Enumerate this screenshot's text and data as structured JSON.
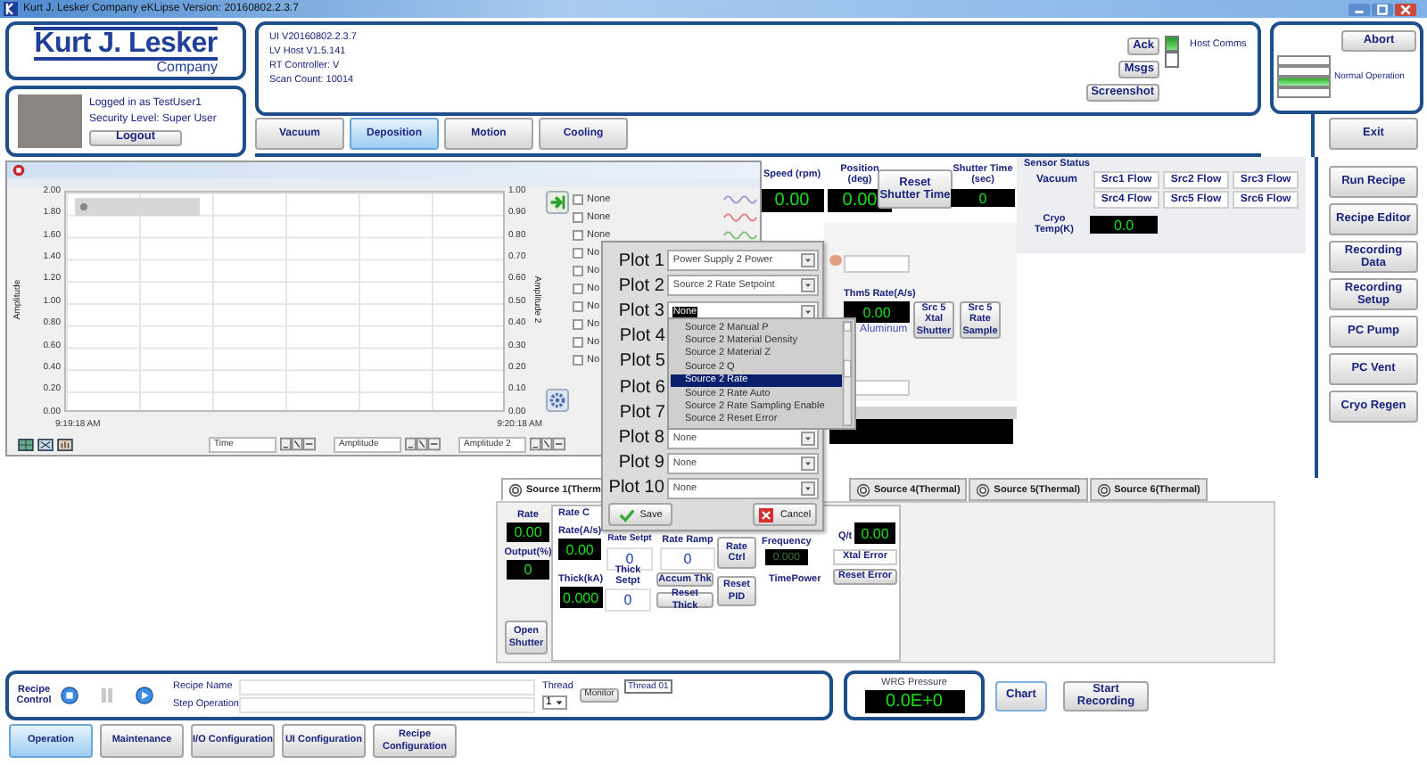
{
  "window": {
    "title": "Kurt J. Lesker Company eKLipse Version: 20160802.2.3.7"
  },
  "logo": {
    "name": "Kurt J. Lesker",
    "subtitle": "Company"
  },
  "login": {
    "user": "Logged in as TestUser1",
    "security": "Security Level: Super User",
    "logout": "Logout"
  },
  "versions": [
    "UI V20160802.2.3.7",
    "LV Host V1.5.141",
    "RT Controller: V",
    "Scan Count: 10014"
  ],
  "message_buttons": [
    "Ack",
    "Msgs",
    "Screenshot"
  ],
  "host_comms": {
    "label": "Host Comms",
    "lights": [
      {
        "on": true
      },
      {
        "on": false
      }
    ]
  },
  "system_status": {
    "abort": "Abort",
    "lights": [
      {
        "on": false
      },
      {
        "on": false
      },
      {
        "on": true
      },
      {
        "on": false
      }
    ],
    "label": "Normal Operation"
  },
  "tabs": [
    {
      "label": "Vacuum",
      "selected": false
    },
    {
      "label": "Deposition",
      "selected": true
    },
    {
      "label": "Motion",
      "selected": false
    },
    {
      "label": "Cooling",
      "selected": false
    }
  ],
  "exit": "Exit",
  "side_buttons": [
    "Run Recipe",
    "Recipe Editor",
    "Recording Data",
    "Recording Setup",
    "PC Pump",
    "PC Vent",
    "Cryo Regen"
  ],
  "motion": [
    {
      "label": "Speed (rpm)",
      "value": "0.00"
    },
    {
      "label": "Position (deg)",
      "value": "0.00"
    }
  ],
  "shutter": {
    "reset": "Reset Shutter Time",
    "label": "Shutter Time (sec)",
    "value": "0"
  },
  "sensor_status": {
    "title": "Sensor Status",
    "tabs": [
      {
        "label": "Vacuum",
        "selected": true
      },
      {
        "label": "Src1 Flow",
        "selected": false
      },
      {
        "label": "Src2 Flow",
        "selected": false
      },
      {
        "label": "Src3 Flow",
        "selected": false
      },
      {
        "label": "Src4 Flow",
        "selected": false
      },
      {
        "label": "Src5 Flow",
        "selected": false
      },
      {
        "label": "Src6 Flow",
        "selected": false
      }
    ],
    "cryo_label": "Cryo Temp(K)",
    "cryo_value": "0.0"
  },
  "source5": {
    "label": "Thm5 Rate(A/s)",
    "value": "0.00",
    "material": "Aluminum",
    "buttons": [
      "Src 5 Xtal Shutter",
      "Src 5 Rate Sample"
    ]
  },
  "source_tabs": [
    {
      "label": "Source 1(Therm",
      "selected": true
    },
    {
      "label": "Source 4(Thermal)",
      "selected": false
    },
    {
      "label": "Source 5(Thermal)",
      "selected": false
    },
    {
      "label": "Source 6(Thermal)",
      "selected": false
    }
  ],
  "source_panel": {
    "rate_label": "Rate",
    "rate": "0.00",
    "output_label": "Output(%)",
    "output": "0",
    "open_shutter": "Open Shutter",
    "rate_control": {
      "title": "Rate C",
      "rate_label": "Rate(A/s)",
      "rate": "0.00",
      "setpt_label": "Rate Setpt",
      "setpt": "0",
      "ramp_label": "Rate Ramp",
      "ramp": "0",
      "rate_ctrl": "Rate Ctrl",
      "thick_label": "Thick(kA)",
      "thick": "0.000",
      "thick_setpt_label": "Thick Setpt",
      "thick_setpt": "0",
      "accum": "Accum Thk",
      "reset_thick": "Reset Thick",
      "reset_pid": "Reset PID",
      "frequency_label": "Frequency",
      "frequency": "0.000",
      "timepower": "TimePower",
      "qt_label": "Q/t",
      "qt": "0.00",
      "xtal_error": "Xtal Error",
      "reset_error": "Reset Error"
    }
  },
  "recipe": {
    "title": "Recipe Control",
    "name_label": "Recipe Name",
    "step_label": "Step Operation",
    "thread_label": "Thread",
    "thread_value": "1",
    "monitor": "Monitor",
    "thread_tag": "Thread 01"
  },
  "wrg": {
    "label": "WRG Pressure",
    "value": "0.0E+0"
  },
  "chart_button": "Chart",
  "start_recording": "Start Recording",
  "nav_tabs": [
    {
      "label": "Operation",
      "selected": true
    },
    {
      "label": "Maintenance",
      "selected": false
    },
    {
      "label": "I/O Configuration",
      "selected": false
    },
    {
      "label": "UI Configuration",
      "selected": false
    },
    {
      "label": "Recipe Configuration",
      "selected": false
    }
  ],
  "chart_window": {
    "ylabel": "Amplitude",
    "y2label": "Amplitude 2",
    "y_ticks": [
      "2.00",
      "1.80",
      "1.60",
      "1.40",
      "1.20",
      "1.00",
      "0.80",
      "0.60",
      "0.40",
      "0.20",
      "0.00"
    ],
    "y2_ticks": [
      "1.00",
      "0.90",
      "0.80",
      "0.70",
      "0.60",
      "0.50",
      "0.40",
      "0.30",
      "0.20",
      "0.10",
      "0.00"
    ],
    "time_start": "9:19:18 AM",
    "time_end": "9:20:18 AM",
    "legend": [
      {
        "label": "None",
        "checked": false,
        "color": "#9a9ad0"
      },
      {
        "label": "None",
        "checked": false,
        "color": "#e07a7a"
      },
      {
        "label": "None",
        "checked": false,
        "color": "#7ac07a"
      },
      {
        "label": "No",
        "checked": false
      },
      {
        "label": "No",
        "checked": false
      },
      {
        "label": "No",
        "checked": false
      },
      {
        "label": "No",
        "checked": false
      },
      {
        "label": "No",
        "checked": false
      },
      {
        "label": "No",
        "checked": false
      },
      {
        "label": "No",
        "checked": false
      }
    ],
    "axis_fields": [
      "Time",
      "Amplitude",
      "Amplitude 2"
    ]
  },
  "plot_dialog": {
    "plots": [
      {
        "label": "Plot 1",
        "value": "Power Supply 2 Power",
        "text_selected": false
      },
      {
        "label": "Plot 2",
        "value": "Source 2 Rate Setpoint",
        "text_selected": false
      },
      {
        "label": "Plot 3",
        "value": "None",
        "text_selected": true
      },
      {
        "label": "Plot 4"
      },
      {
        "label": "Plot 5"
      },
      {
        "label": "Plot 6"
      },
      {
        "label": "Plot 7"
      },
      {
        "label": "Plot 8",
        "value": "None",
        "text_selected": false
      },
      {
        "label": "Plot 9",
        "value": "None",
        "text_selected": false
      },
      {
        "label": "Plot 10",
        "value": "None",
        "text_selected": false
      }
    ],
    "options": [
      {
        "label": "Source 2 Manual P",
        "selected": false
      },
      {
        "label": "Source 2 Material Density",
        "selected": false
      },
      {
        "label": "Source 2 Material Z",
        "selected": false
      },
      {
        "label": "Source 2 Q",
        "selected": false
      },
      {
        "label": "Source 2 Rate",
        "selected": true
      },
      {
        "label": "Source 2 Rate Auto",
        "selected": false
      },
      {
        "label": "Source 2 Rate Sampling Enable",
        "selected": false
      },
      {
        "label": "Source 2 Reset Error",
        "selected": false
      }
    ],
    "save": "Save",
    "cancel": "Cancel"
  }
}
